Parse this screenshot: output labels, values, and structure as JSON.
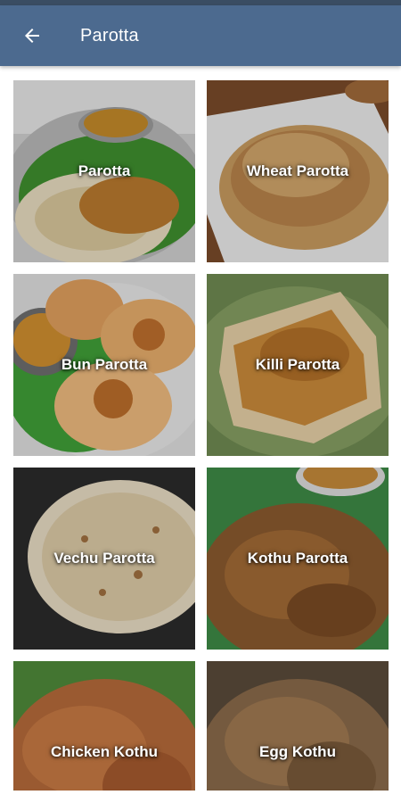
{
  "app_bar": {
    "title": "Parotta",
    "back_icon": "arrow-left-icon",
    "background": "#4c6a8f"
  },
  "items": [
    {
      "label": "Parotta"
    },
    {
      "label": "Wheat Parotta"
    },
    {
      "label": "Bun Parotta"
    },
    {
      "label": "Killi Parotta"
    },
    {
      "label": "Vechu Parotta"
    },
    {
      "label": "Kothu Parotta"
    },
    {
      "label": "Chicken Kothu"
    },
    {
      "label": "Egg Kothu"
    }
  ]
}
